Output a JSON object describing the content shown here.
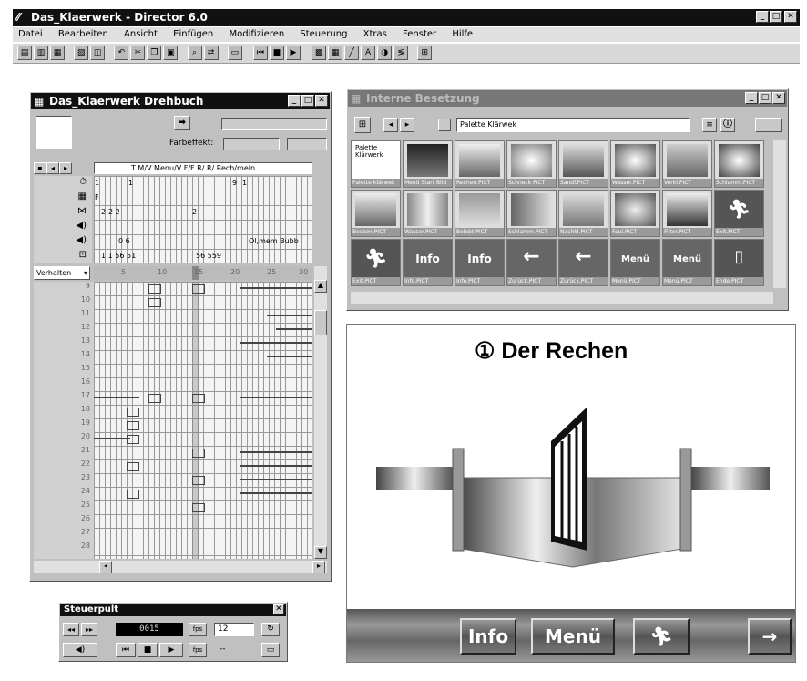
{
  "app": {
    "title": "Das_Klaerwerk - Director 6.0",
    "menu": [
      "Datei",
      "Bearbeiten",
      "Ansicht",
      "Einfügen",
      "Modifizieren",
      "Steuerung",
      "Xtras",
      "Fenster",
      "Hilfe"
    ]
  },
  "score": {
    "title": "Das_Klaerwerk Drehbuch",
    "color_label": "Farbeffekt:",
    "header_label": "T M/V Menu/V F/F R/ R/ Rech/mein",
    "behavior_label": "Verhalten",
    "effect_values": [
      "1",
      "1",
      "",
      "",
      "9",
      "1",
      "F",
      "",
      "",
      "",
      "",
      "",
      "2-2 2",
      "",
      "2",
      "",
      "",
      "",
      "",
      "0 6",
      "",
      "",
      "",
      "Ol,mem Bubb",
      "1 1 56 51",
      "56 559"
    ],
    "frame_ticks": [
      "5",
      "10",
      "15",
      "20",
      "25",
      "30"
    ],
    "channels": [
      "9",
      "10",
      "11",
      "12",
      "13",
      "14",
      "15",
      "16",
      "17",
      "18",
      "19",
      "20",
      "21",
      "22",
      "23",
      "24",
      "25",
      "26",
      "27",
      "28"
    ]
  },
  "cast": {
    "title": "Interne Besetzung",
    "palette_field": "Palette Klärwek",
    "members": [
      "Palette Klärwek",
      "Menü Start Bild",
      "Rechen.PICT",
      "Schneck PICT",
      "Sandf.PICT",
      "Wasser.PICT",
      "Vorkl.PICT",
      "Schlamm.PICT",
      "Becken.PICT",
      "Wasser.PICT",
      "Belebt.PICT",
      "Schlamm.PICT",
      "Nachkl.PICT",
      "Faul.PICT",
      "Filter.PICT",
      "Exit.PICT",
      "Exit.PICT",
      "Info.PICT",
      "Info.PICT",
      "Zurück.PICT",
      "Zurück.PICT",
      "Menü.PICT",
      "Menü.PICT",
      "Ende.PICT"
    ],
    "tile_texts": [
      "Info",
      "Info",
      "Menü",
      "Menü"
    ]
  },
  "stage": {
    "heading": "① Der Rechen",
    "buttons": {
      "info": "Info",
      "menu": "Menü",
      "next_arrow": "→"
    }
  },
  "control": {
    "title": "Steuerpult",
    "frame": "0015",
    "tempo": "12",
    "loop_label": "--"
  }
}
